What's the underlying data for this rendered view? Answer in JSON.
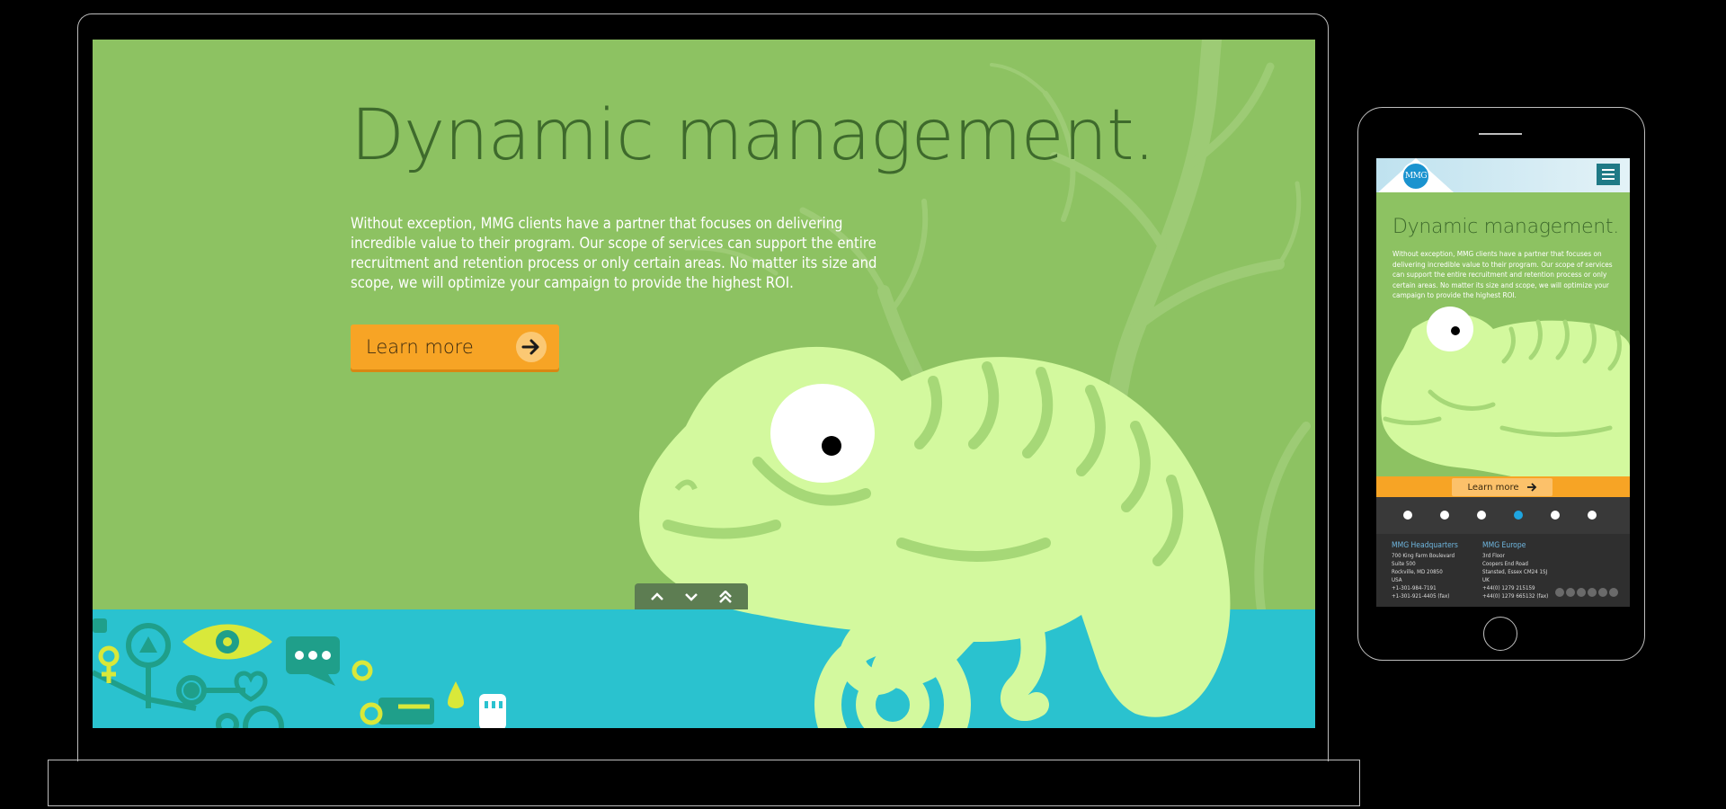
{
  "hero": {
    "title": "Dynamic management.",
    "body": "Without exception, MMG clients have a partner that focuses on delivering incredible value to their program. Our scope of services can support the entire recruitment and retention process or only certain areas. No matter its size and scope, we will optimize your campaign to provide the highest ROI.",
    "cta_label": "Learn more"
  },
  "mobile": {
    "logo_text": "MMG",
    "title": "Dynamic management.",
    "body": "Without exception, MMG clients have a partner that focuses on delivering incredible value to their program. Our scope of services can support the entire recruitment and retention process or only certain areas. No matter its size and scope, we will optimize your campaign to provide the highest ROI.",
    "cta_label": "Learn more",
    "active_slide": 4,
    "slide_count": 6
  },
  "footer": {
    "hq": {
      "heading": "MMG Headquarters",
      "lines": [
        "700 King Farm Boulevard",
        "Suite 500",
        "Rockville, MD 20850",
        "USA",
        "+1-301-984-7191",
        "+1-301-921-4405 (fax)"
      ]
    },
    "europe": {
      "heading": "MMG Europe",
      "lines": [
        "3rd Floor",
        "Coopers End Road",
        "Stansted, Essex CM24 1SJ",
        "UK",
        "+44(0) 1279 215159",
        "+44(0) 1279 665132 (fax)"
      ]
    }
  },
  "colors": {
    "hero_green": "#8dc262",
    "chameleon": "#d3f99e",
    "ground_teal": "#2ac2cf",
    "cta_orange": "#f7a425",
    "active_dot": "#1ea5e0"
  }
}
